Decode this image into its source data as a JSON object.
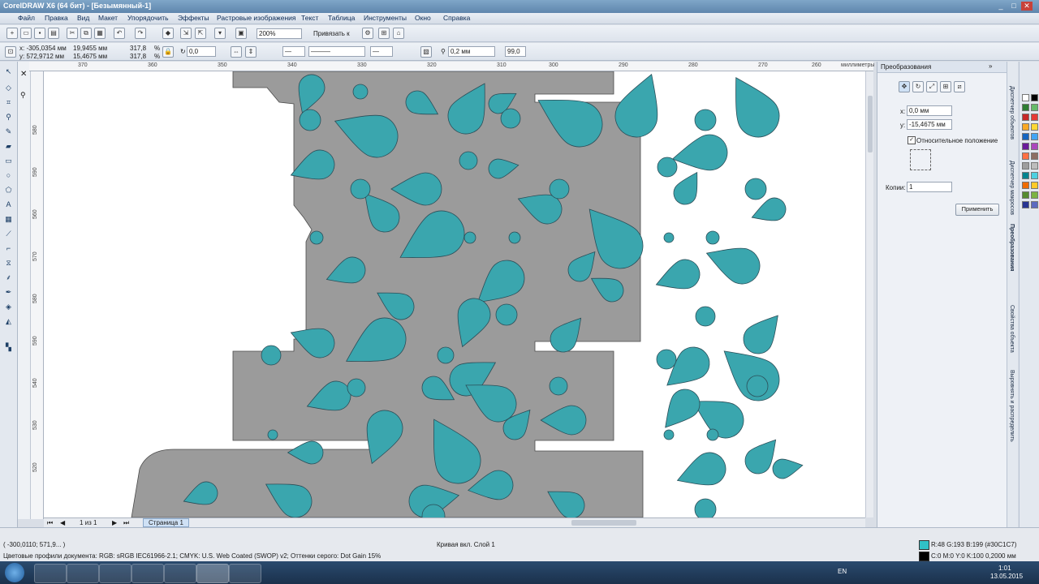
{
  "window": {
    "title": "CorelDRAW X6 (64 бит) - [Безымянный-1]",
    "min": "_",
    "max": "□",
    "close": "✕"
  },
  "menu": [
    "Файл",
    "Правка",
    "Вид",
    "Макет",
    "Упорядочить",
    "Эффекты",
    "Растровые изображения",
    "Текст",
    "Таблица",
    "Инструменты",
    "Окно",
    "Справка"
  ],
  "standard_toolbar": {
    "zoom": "200%",
    "snap_label": "Привязать к"
  },
  "property_bar": {
    "x": "x: -305,0354 мм",
    "y": "y: 572,9712 мм",
    "w": "19,9455 мм",
    "h": "15,4675 мм",
    "scale_w": "317,8",
    "scale_h": "317,8",
    "pct": "%",
    "angle": "0,0",
    "outline": "0,2 мм",
    "value": "99,0"
  },
  "ruler_h": {
    "ticks": [
      "370",
      "360",
      "350",
      "340",
      "330",
      "320",
      "310",
      "300",
      "290",
      "280",
      "270",
      "260"
    ],
    "unit": "миллиметры"
  },
  "ruler_v": [
    "580",
    "590",
    "560",
    "570",
    "580",
    "590",
    "540",
    "530",
    "520"
  ],
  "docker": {
    "title": "Преобразования",
    "x_label": "x:",
    "x_value": "0,0 мм",
    "y_label": "y:",
    "y_value": "-15,4675 мм",
    "relative": "Относительное положение",
    "copies_label": "Копии:",
    "copies_value": "1",
    "apply": "Применить"
  },
  "docker_tabs": [
    "Диспетчер объектов",
    "Диспетчер макросов",
    "Преобразования",
    "Свойства объекта",
    "Выровнять и распределить"
  ],
  "page_nav": {
    "count": "1 из 1",
    "page_tab": "Страница 1"
  },
  "status": {
    "coords": "( -300,0110; 571,9... )",
    "object": "Кривая вкл. Слой 1",
    "profiles": "Цветовые профили документа: RGB: sRGB IEC61966-2.1; CMYK: U.S. Web Coated (SWOP) v2; Оттенки серого: Dot Gain 15%",
    "fill": "R:48 G:193 B:199 (#30C1C7)",
    "outline": "C:0 M:0 Y:0 K:100  0,2000 мм"
  },
  "taskbar": {
    "lang": "EN",
    "time": "1:01",
    "date": "13.05.2015"
  },
  "colors": {
    "teal": "#3aa6ae",
    "gray": "#9b9b9b",
    "grayDark": "#8a8a8a",
    "outline": "#2b4e58"
  },
  "palette": [
    "#ffffff",
    "#000000",
    "#2e7d32",
    "#66bb6a",
    "#c62828",
    "#e53935",
    "#f9a825",
    "#fdd835",
    "#1565c0",
    "#42a5f5",
    "#6a1b9a",
    "#ab47bc",
    "#ff7043",
    "#8d6e63",
    "#9e9e9e",
    "#bdbdbd",
    "#00838f",
    "#4dd0e1",
    "#ef6c00",
    "#ffca28",
    "#558b2f",
    "#7cb342",
    "#283593",
    "#5c6bc0"
  ]
}
